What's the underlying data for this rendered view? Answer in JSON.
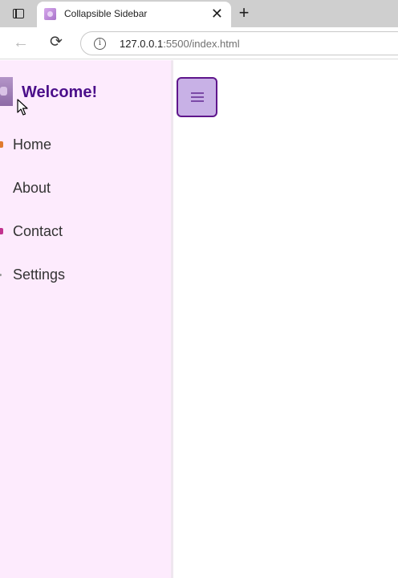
{
  "browser": {
    "tab_title": "Collapsible Sidebar",
    "close_glyph": "✕",
    "new_tab_glyph": "+",
    "back_glyph": "←",
    "reload_glyph": "⟳",
    "info_glyph": "i",
    "url_host": "127.0.0.1",
    "url_rest": ":5500/index.html"
  },
  "sidebar": {
    "welcome": "Welcome!",
    "items": [
      {
        "label": "Home",
        "icon": "home-icon",
        "icon_color": "#e07a2e"
      },
      {
        "label": "About",
        "icon": "about-icon",
        "icon_color": "#fdebfd"
      },
      {
        "label": "Contact",
        "icon": "contact-icon",
        "icon_color": "#c2338f"
      },
      {
        "label": "Settings",
        "icon": "settings-icon",
        "icon_color": "#9a9a9a"
      }
    ]
  },
  "toggle": {
    "icon": "hamburger-icon"
  },
  "colors": {
    "sidebar_bg": "#fdebfd",
    "welcome_text": "#4b0f8a",
    "toggle_bg": "#c8b1e6",
    "toggle_border": "#5f168c"
  }
}
